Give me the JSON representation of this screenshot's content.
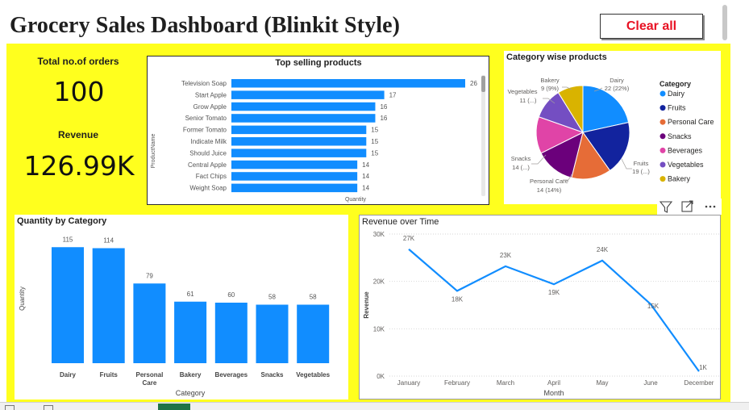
{
  "header": {
    "title": "Grocery Sales Dashboard (Blinkit Style)",
    "clear_label": "Clear all"
  },
  "kpis": {
    "orders_label": "Total no.of orders",
    "orders_value": "100",
    "revenue_label": "Revenue",
    "revenue_value": "126.99K"
  },
  "visual_header_icons": [
    "filter-icon",
    "focus-mode-icon",
    "more-options-icon"
  ],
  "colors": {
    "canvas_yellow": "#ffff1e",
    "bar_blue": "#118dff",
    "line_blue": "#118dff",
    "clear_red": "#e81123"
  },
  "chart_data": [
    {
      "type": "bar",
      "orientation": "horizontal",
      "title": "Top selling products",
      "xlabel": "Quantity",
      "ylabel": "ProductName",
      "categories": [
        "Television Soap",
        "Start Apple",
        "Grow Apple",
        "Senior Tomato",
        "Former Tomato",
        "Indicate Milk",
        "Should Juice",
        "Central Apple",
        "Fact Chips",
        "Weight Soap"
      ],
      "values": [
        26,
        17,
        16,
        16,
        15,
        15,
        15,
        14,
        14,
        14
      ],
      "xlim": [
        0,
        26
      ]
    },
    {
      "type": "pie",
      "title": "Category wise products",
      "legend_title": "Category",
      "legend_position": "right",
      "categories": [
        "Dairy",
        "Fruits",
        "Personal Care",
        "Snacks",
        "Beverages",
        "Vegetables",
        "Bakery"
      ],
      "values": [
        22,
        19,
        14,
        14,
        13,
        11,
        9
      ],
      "colors": [
        "#118dff",
        "#12239e",
        "#e66c37",
        "#6b007b",
        "#e044a7",
        "#744ec2",
        "#d9b300"
      ],
      "data_labels": [
        {
          "name": "Dairy",
          "value": "22 (22%)"
        },
        {
          "name": "Fruits",
          "value": "19 (...)"
        },
        {
          "name": "Personal Care",
          "value": "14 (14%)"
        },
        {
          "name": "Snacks",
          "value": "14 (...)"
        },
        {
          "name": "Vegetables",
          "value": "11 (...)"
        },
        {
          "name": "Bakery",
          "value": "9 (9%)"
        }
      ]
    },
    {
      "type": "bar",
      "title": "Quantity by Category",
      "xlabel": "Category",
      "ylabel": "Quantity",
      "categories": [
        "Dairy",
        "Fruits",
        "Personal Care",
        "Bakery",
        "Beverages",
        "Snacks",
        "Vegetables"
      ],
      "values": [
        115,
        114,
        79,
        61,
        60,
        58,
        58
      ],
      "ylim": [
        0,
        120
      ]
    },
    {
      "type": "line",
      "title": "Revenue over Time",
      "xlabel": "Month",
      "ylabel": "Revenue",
      "x": [
        "January",
        "February",
        "March",
        "April",
        "May",
        "June",
        "December"
      ],
      "values": [
        26.8,
        18.0,
        23.2,
        19.4,
        24.4,
        15.2,
        1.0
      ],
      "data_labels": [
        "27K",
        "18K",
        "23K",
        "19K",
        "24K",
        "15K",
        "1K"
      ],
      "yticks": [
        "0K",
        "10K",
        "20K",
        "30K"
      ],
      "ylim": [
        0,
        30
      ],
      "grid": true
    }
  ]
}
